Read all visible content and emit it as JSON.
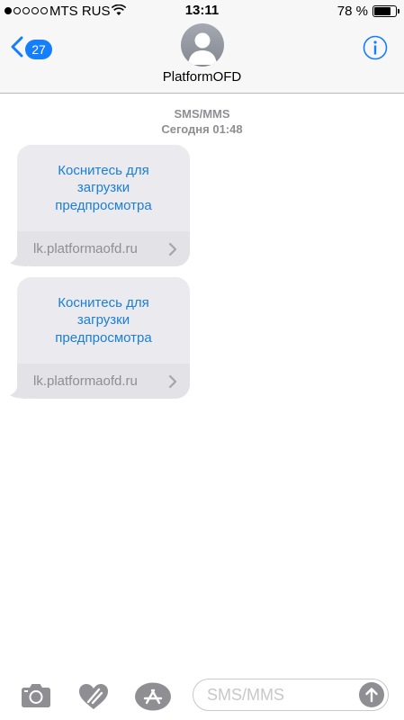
{
  "status_bar": {
    "carrier": "MTS RUS",
    "time": "13:11",
    "battery_percent": "78 %",
    "battery_level": 0.78,
    "signal_bars_filled": 1,
    "signal_bars_total": 5
  },
  "nav": {
    "back_count": "27",
    "contact_name": "PlatformOFD",
    "accent_color": "#157efb"
  },
  "thread": {
    "message_type": "SMS/MMS",
    "timestamp": "Сегодня 01:48",
    "messages": [
      {
        "preview_text": "Коснитесь для загрузки предпросмотра",
        "link": "lk.platformaofd.ru"
      },
      {
        "preview_text": "Коснитесь для загрузки предпросмотра",
        "link": "lk.platformaofd.ru"
      }
    ]
  },
  "compose": {
    "placeholder": "SMS/MMS",
    "value": ""
  },
  "icons": {
    "camera": "camera-icon",
    "digital_touch": "digital-touch-icon",
    "app_store": "app-store-icon",
    "send": "send-arrow-icon"
  }
}
